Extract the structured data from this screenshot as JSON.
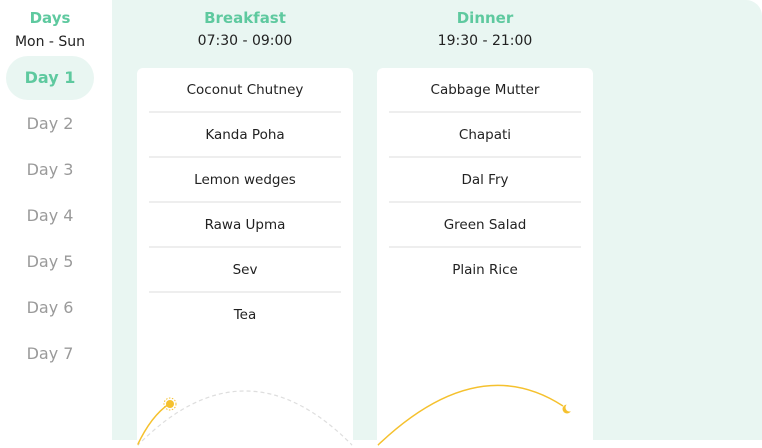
{
  "accent_color": "#5ec99f",
  "sun_color": "#f5c12e",
  "sidebar": {
    "title": "Days",
    "subtitle": "Mon - Sun",
    "days": [
      "Day 1",
      "Day 2",
      "Day 3",
      "Day 4",
      "Day 5",
      "Day 6",
      "Day 7"
    ],
    "active_day": "Day 1"
  },
  "meals": [
    {
      "title": "Breakfast",
      "time": "07:30 - 09:00",
      "icon": "sun-icon",
      "items": [
        "Coconut Chutney",
        "Kanda Poha",
        "Lemon wedges",
        "Rawa Upma",
        "Sev",
        "Tea"
      ]
    },
    {
      "title": "Dinner",
      "time": "19:30 - 21:00",
      "icon": "moon-icon",
      "items": [
        "Cabbage Mutter",
        "Chapati",
        "Dal Fry",
        "Green Salad",
        "Plain Rice"
      ]
    }
  ]
}
